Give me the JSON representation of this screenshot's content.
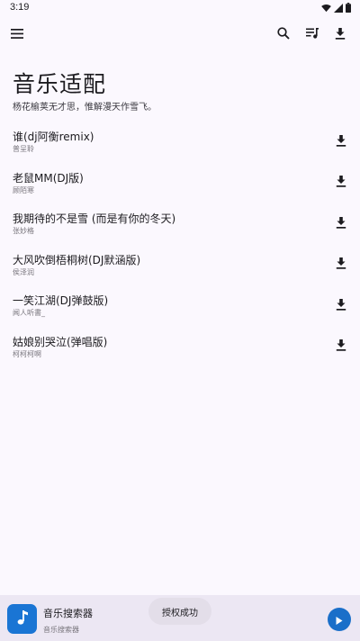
{
  "status_bar": {
    "time": "3:19"
  },
  "header": {
    "title": "音乐适配",
    "subtitle": "杨花榆荚无才思，惟解漫天作雪飞。"
  },
  "songs": [
    {
      "title": "谁(dj阿衡remix)",
      "artist": "普呈聆"
    },
    {
      "title": "老鼠MM(DJ版)",
      "artist": "顾陌寒"
    },
    {
      "title": "我期待的不是雪 (而是有你的冬天)",
      "artist": "张妙格"
    },
    {
      "title": "大风吹倒梧桐树(DJ默涵版)",
      "artist": "侯泽润"
    },
    {
      "title": "一笑江湖(DJ弹鼓版)",
      "artist": "闻人听書_"
    },
    {
      "title": "姑娘别哭泣(弹唱版)",
      "artist": "柯柯柯啊"
    }
  ],
  "player": {
    "title": "音乐搜索器",
    "subtitle": "音乐搜索器"
  },
  "toast": {
    "text": "授权成功"
  },
  "icons": {
    "menu": "menu-icon",
    "search": "search-icon",
    "playlist": "playlist-icon",
    "download": "download-icon",
    "note": "music-note-icon",
    "play": "play-icon"
  },
  "colors": {
    "background": "#fbf8fe",
    "accent": "#1a75d4",
    "player_bg": "#ece7f3"
  }
}
